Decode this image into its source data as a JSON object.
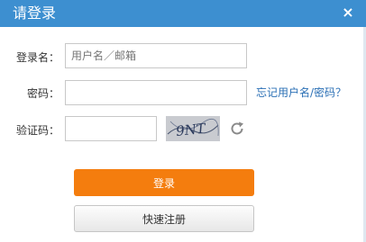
{
  "dialog": {
    "title": "请登录",
    "close_label": "×"
  },
  "form": {
    "username_label": "登录名：",
    "username_placeholder": "用户名／邮箱",
    "password_label": "密码：",
    "forgot_link": "忘记用户名/密码？",
    "captcha_label": "验证码：",
    "captcha_text": "9NT"
  },
  "buttons": {
    "login_label": "登录",
    "register_label": "快速注册"
  },
  "colors": {
    "title_bar": "#3d8fd0",
    "login_button": "#f47d0e",
    "link": "#2a6fb5"
  }
}
